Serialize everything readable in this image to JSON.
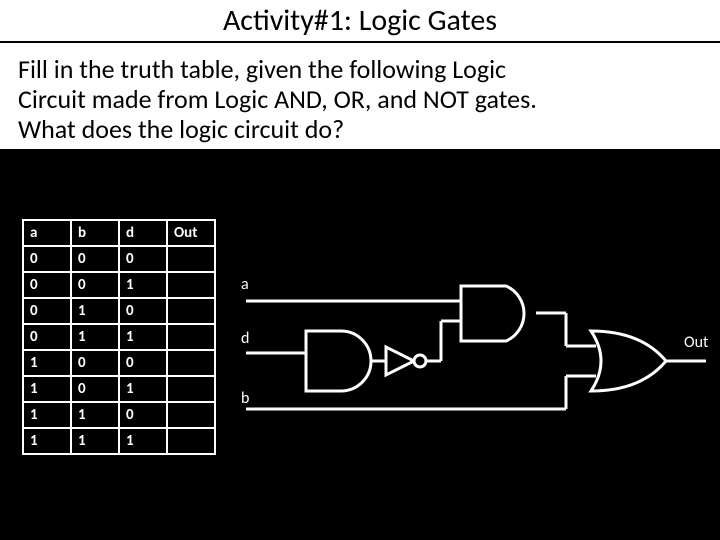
{
  "title": "Activity#1: Logic Gates",
  "body_line1": "Fill in the truth table, given the following Logic",
  "body_line2": "Circuit made from Logic AND, OR, and NOT gates.",
  "body_line3": "What does the logic circuit do?",
  "table": {
    "headers": [
      "a",
      "b",
      "d",
      "Out"
    ],
    "rows": [
      [
        "0",
        "0",
        "0",
        ""
      ],
      [
        "0",
        "0",
        "1",
        ""
      ],
      [
        "0",
        "1",
        "0",
        ""
      ],
      [
        "0",
        "1",
        "1",
        ""
      ],
      [
        "1",
        "0",
        "0",
        ""
      ],
      [
        "1",
        "0",
        "1",
        ""
      ],
      [
        "1",
        "1",
        "0",
        ""
      ],
      [
        "1",
        "1",
        "1",
        ""
      ]
    ]
  },
  "labels": {
    "a": "a",
    "d": "d",
    "b": "b",
    "out": "Out"
  },
  "chart_data": {
    "type": "diagram",
    "description": "Logic circuit with three inputs a, d, b. Contains two AND gates, one NOT gate, and one OR gate producing output Out.",
    "inputs": [
      "a",
      "d",
      "b"
    ],
    "gates": [
      "AND",
      "AND",
      "NOT",
      "OR"
    ],
    "output": "Out"
  }
}
